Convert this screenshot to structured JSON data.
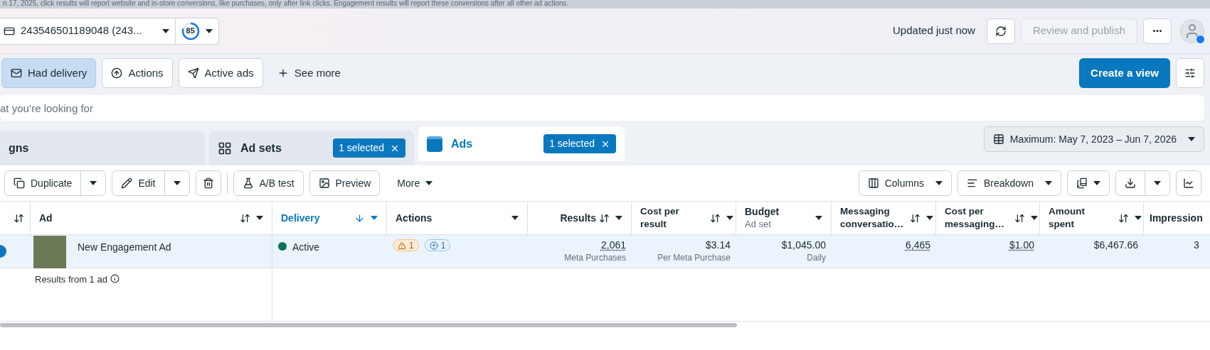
{
  "banner": {
    "text": "n 17, 2025, click results will report website and in-store conversions, like purchases, only after link clicks. Engagement results will report these conversions after all other ad actions."
  },
  "header": {
    "account": "243546501189048 (243...",
    "score": "85",
    "updated": "Updated just now",
    "review": {
      "label": "Review and publish",
      "disabled": true
    }
  },
  "filters": [
    {
      "label": "Had delivery",
      "selected": true
    },
    {
      "label": "Actions",
      "selected": false
    },
    {
      "label": "Active ads",
      "selected": false
    }
  ],
  "see_more": "See more",
  "create_view": "Create a view",
  "search": {
    "placeholder": "at you’re looking for"
  },
  "level_tabs": [
    {
      "label": "gns",
      "selected": false
    },
    {
      "label": "Ad sets",
      "selected": false,
      "badge": "1 selected"
    },
    {
      "label": "Ads",
      "selected": true,
      "badge": "1 selected"
    }
  ],
  "date_range": "Maximum: May 7, 2023 – Jun 7, 2026",
  "toolbar_left": [
    {
      "kind": "split",
      "label": "Duplicate"
    },
    {
      "kind": "split",
      "label": "Edit"
    },
    {
      "kind": "icon"
    },
    {
      "kind": "button",
      "label": "A/B test"
    },
    {
      "kind": "button",
      "label": "Preview"
    },
    {
      "kind": "menu",
      "label": "More"
    }
  ],
  "toolbar_right": [
    {
      "kind": "dropdown",
      "label": "Columns"
    },
    {
      "kind": "dropdown",
      "label": "Breakdown"
    },
    {
      "kind": "icon-dropdown"
    },
    {
      "kind": "split-icon"
    },
    {
      "kind": "icon"
    }
  ],
  "table": {
    "columns": [
      {
        "sortable": true,
        "sorted": false,
        "menu": false
      },
      {
        "label": "Ad",
        "sortable": true,
        "sorted": false,
        "menu": true
      },
      {
        "label": "Delivery",
        "sortable": true,
        "sorted": true,
        "menu": true
      },
      {
        "label": "Actions",
        "sortable": false,
        "sorted": false,
        "menu": true
      },
      {
        "label": "Results",
        "sortable": true,
        "sorted": false,
        "menu": true
      },
      {
        "label": "Cost per result",
        "sortable": true,
        "sorted": false,
        "menu": true
      },
      {
        "label": "Budget",
        "sublabel": "Ad set",
        "sortable": false,
        "sorted": false,
        "menu": true
      },
      {
        "label": "Messaging conversatio…",
        "sortable": true,
        "sorted": false,
        "menu": true
      },
      {
        "label": "Cost per messaging…",
        "sortable": true,
        "sorted": false,
        "menu": true
      },
      {
        "label": "Amount spent",
        "sortable": true,
        "sorted": false,
        "menu": true
      },
      {
        "label": "Impression"
      }
    ],
    "rows": [
      {
        "selected": true,
        "name": "New Engagement Ad",
        "status": {
          "label": "Active",
          "color": "#0a7153"
        },
        "actions": [
          {
            "kind": "warning",
            "count": "1"
          },
          {
            "kind": "info",
            "count": "1"
          }
        ],
        "values": [
          {
            "main": "2,061",
            "sub": "Meta Purchases",
            "dotted": true
          },
          {
            "main": "$3.14",
            "sub": "Per Meta Purchase",
            "dotted": false
          },
          {
            "main": "$1,045.00",
            "sub": "Daily",
            "dotted": false
          },
          {
            "main": "6,465",
            "dotted": true
          },
          {
            "main": "$1.00",
            "dotted": true
          },
          {
            "main": "$6,467.66",
            "dotted": false
          },
          {
            "main": "3",
            "dotted": false
          }
        ]
      }
    ],
    "summary": "Results from 1 ad"
  }
}
